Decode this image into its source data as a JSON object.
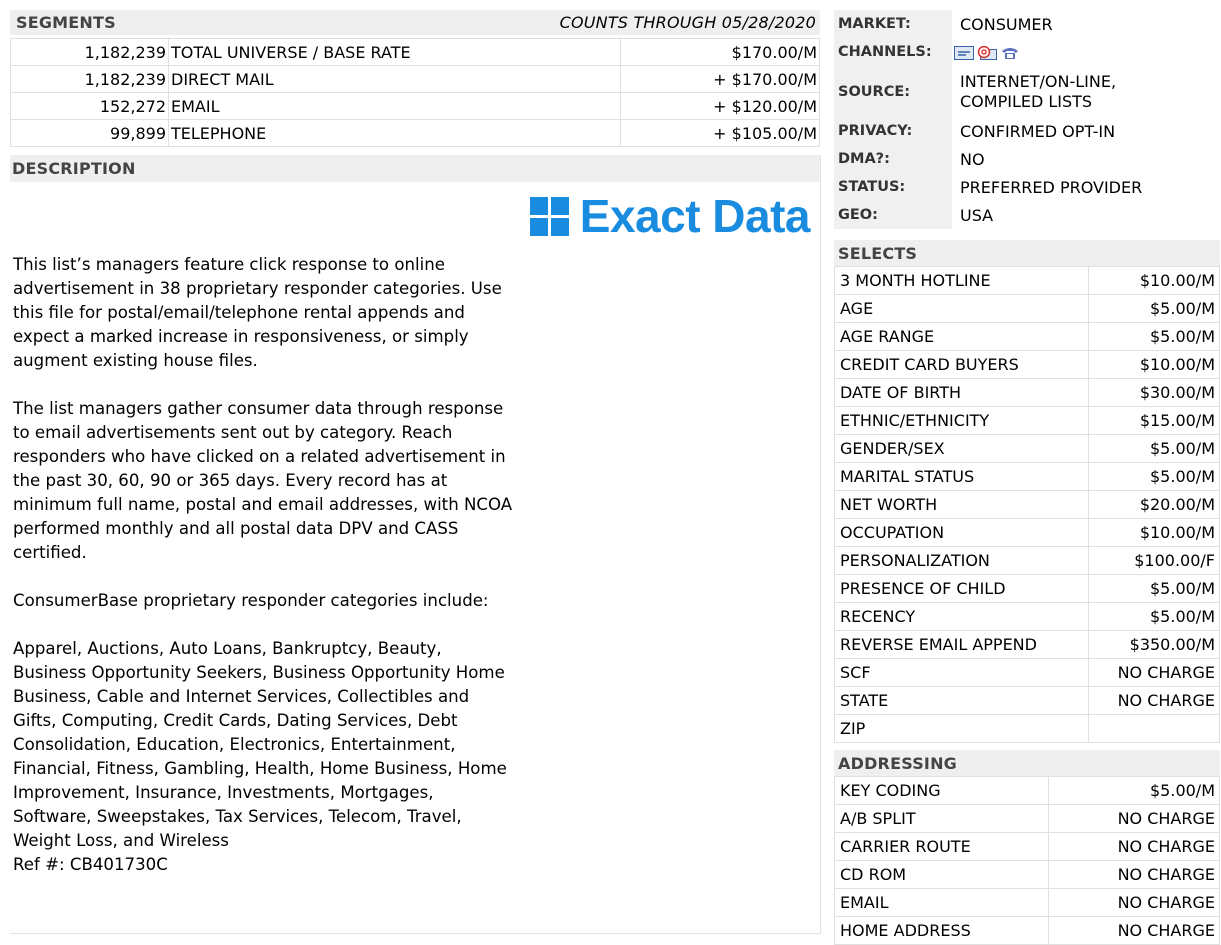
{
  "segments": {
    "header": "SEGMENTS",
    "counts_through": "COUNTS THROUGH 05/28/2020",
    "rows": [
      {
        "count": "1,182,239",
        "name": "TOTAL UNIVERSE / BASE RATE",
        "price": "$170.00/M"
      },
      {
        "count": "1,182,239",
        "name": "DIRECT MAIL",
        "price": "+ $170.00/M"
      },
      {
        "count": "152,272",
        "name": "EMAIL",
        "price": "+ $120.00/M"
      },
      {
        "count": "99,899",
        "name": "TELEPHONE",
        "price": "+ $105.00/M"
      }
    ]
  },
  "description": {
    "header": "DESCRIPTION",
    "logo_text": "Exact Data",
    "brand_color": "#1a8ce0",
    "body": "This list’s managers feature click response to online advertisement in 38 proprietary responder categories. Use this file for postal/email/telephone rental appends and expect a marked increase in responsiveness, or simply augment existing house files.\n\nThe list managers gather consumer data through response to email advertisements sent out by category. Reach responders who have clicked on a related advertisement in the past 30, 60, 90 or 365 days. Every record has at minimum full name, postal and email addresses, with NCOA performed monthly and all postal data DPV and CASS certified.\n\nConsumerBase proprietary responder categories include:\n\nApparel, Auctions, Auto Loans, Bankruptcy, Beauty, Business Opportunity Seekers, Business Opportunity Home Business, Cable and Internet Services, Collectibles and Gifts, Computing, Credit Cards, Dating Services, Debt Consolidation, Education, Electronics, Entertainment, Financial, Fitness, Gambling, Health, Home Business, Home Improvement, Insurance, Investments, Mortgages, Software, Sweepstakes, Tax Services, Telecom, Travel, Weight Loss, and Wireless\nRef #: CB401730C"
  },
  "info": {
    "market_label": "MARKET:",
    "market_value": "CONSUMER",
    "channels_label": "CHANNELS:",
    "channel_icons": [
      "mail-icon",
      "email-icon",
      "telephone-icon"
    ],
    "source_label": "SOURCE:",
    "source_line1": "INTERNET/ON-LINE,",
    "source_line2": "COMPILED LISTS",
    "privacy_label": "PRIVACY:",
    "privacy_value": "CONFIRMED OPT-IN",
    "dma_label": "DMA?:",
    "dma_value": "NO",
    "status_label": "STATUS:",
    "status_value": "PREFERRED PROVIDER",
    "geo_label": "GEO:",
    "geo_value": "USA"
  },
  "selects": {
    "header": "SELECTS",
    "rows": [
      {
        "name": "3 MONTH HOTLINE",
        "price": "$10.00/M"
      },
      {
        "name": "AGE",
        "price": "$5.00/M"
      },
      {
        "name": "AGE RANGE",
        "price": "$5.00/M"
      },
      {
        "name": "CREDIT CARD BUYERS",
        "price": "$10.00/M"
      },
      {
        "name": "DATE OF BIRTH",
        "price": "$30.00/M"
      },
      {
        "name": "ETHNIC/ETHNICITY",
        "price": "$15.00/M"
      },
      {
        "name": "GENDER/SEX",
        "price": "$5.00/M"
      },
      {
        "name": "MARITAL STATUS",
        "price": "$5.00/M"
      },
      {
        "name": "NET WORTH",
        "price": "$20.00/M"
      },
      {
        "name": "OCCUPATION",
        "price": "$10.00/M"
      },
      {
        "name": "PERSONALIZATION",
        "price": "$100.00/F"
      },
      {
        "name": "PRESENCE OF CHILD",
        "price": "$5.00/M"
      },
      {
        "name": "RECENCY",
        "price": "$5.00/M"
      },
      {
        "name": "REVERSE EMAIL APPEND",
        "price": "$350.00/M"
      },
      {
        "name": "SCF",
        "price": "NO CHARGE"
      },
      {
        "name": "STATE",
        "price": "NO CHARGE"
      },
      {
        "name": "ZIP",
        "price": ""
      }
    ]
  },
  "addressing": {
    "header": "ADDRESSING",
    "rows": [
      {
        "name": "KEY CODING",
        "price": "$5.00/M"
      },
      {
        "name": "A/B SPLIT",
        "price": "NO CHARGE"
      },
      {
        "name": "CARRIER ROUTE",
        "price": "NO CHARGE"
      },
      {
        "name": "CD ROM",
        "price": "NO CHARGE"
      },
      {
        "name": "EMAIL",
        "price": "NO CHARGE"
      },
      {
        "name": "HOME ADDRESS",
        "price": "NO CHARGE"
      }
    ]
  }
}
